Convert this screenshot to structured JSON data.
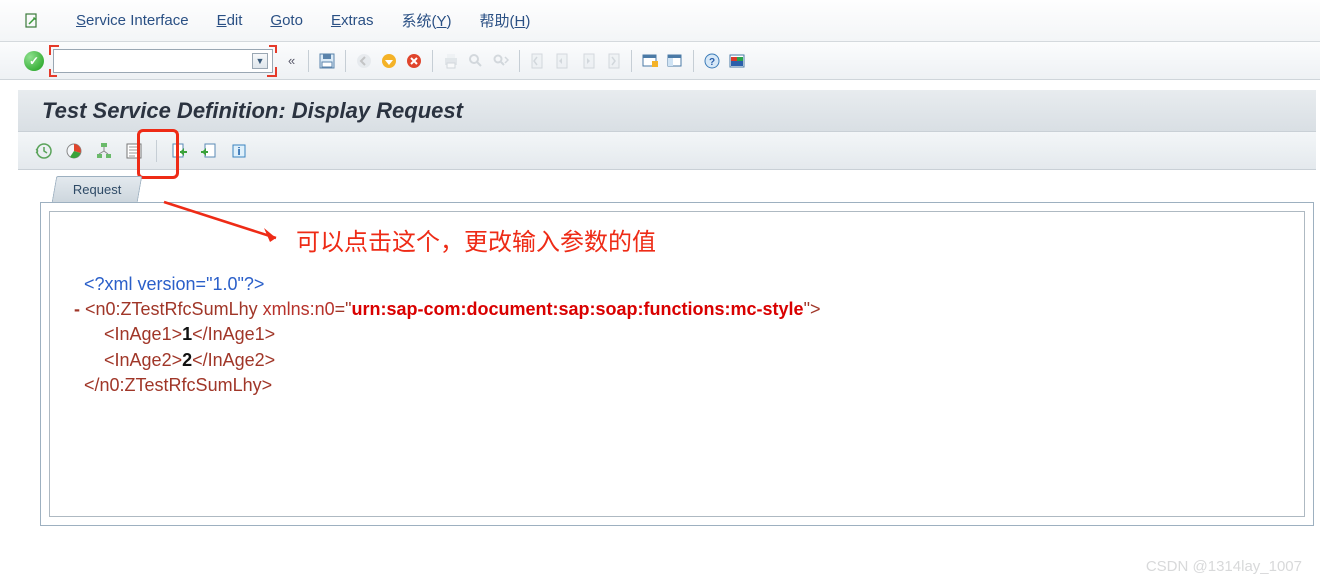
{
  "menu": {
    "items": [
      {
        "pre": "S",
        "rest": "ervice Interface"
      },
      {
        "pre": "E",
        "rest": "dit"
      },
      {
        "pre": "G",
        "rest": "oto"
      },
      {
        "pre": "E",
        "rest": "xtras"
      },
      {
        "full": "系统(",
        "u": "Y",
        "suf": ")"
      },
      {
        "full": "帮助(",
        "u": "H",
        "suf": ")"
      }
    ]
  },
  "toolbar": {
    "chevron": "«"
  },
  "page": {
    "title": "Test Service Definition: Display Request"
  },
  "tab": {
    "label": "Request"
  },
  "annotation": {
    "text": "可以点击这个，更改输入参数的值"
  },
  "xml": {
    "pi": "<?xml version=\"1.0\"?>",
    "open_tag_pre": "<n0:ZTestRfcSumLhy ",
    "open_attr": "xmlns:n0",
    "eq": "=",
    "open_q": "\"",
    "ns": "urn:sap-com:document:sap:soap:functions:mc-style",
    "close_q": "\"",
    "gt": ">",
    "child1_open": "<InAge1>",
    "child1_val": "1",
    "child1_close": "</InAge1>",
    "child2_open": "<InAge2>",
    "child2_val": "2",
    "child2_close": "</InAge2>",
    "close_tag": "</n0:ZTestRfcSumLhy>",
    "minus": "-"
  },
  "watermark": "CSDN @1314lay_1007"
}
